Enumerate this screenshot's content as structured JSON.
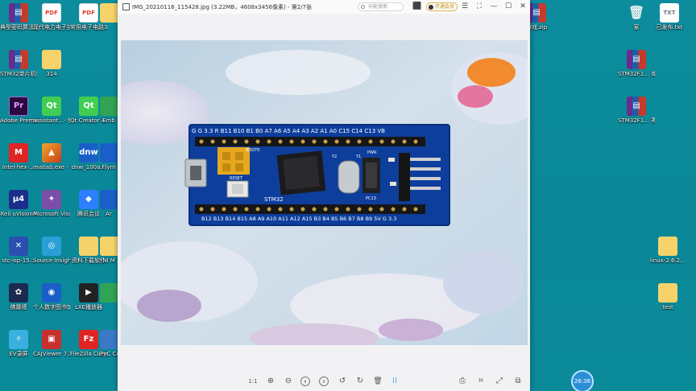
{
  "desktop": {
    "left_icons": [
      {
        "name": "rar-archive-icon",
        "label": "典型密码算法及其C语言…",
        "style": "g-rar",
        "glyph": "▤"
      },
      {
        "name": "pdf-file-icon",
        "label": "现代电力电子技术.pdf",
        "style": "g-pdf",
        "glyph": "PDF"
      },
      {
        "name": "pdf-file-icon",
        "label": "常用电子电路365例.pdf",
        "style": "g-pdf",
        "glyph": "PDF"
      },
      {
        "name": "rar-archive-icon",
        "label": "STM32单片机快速入…",
        "style": "g-rar",
        "glyph": "▤"
      },
      {
        "name": "folder-icon",
        "label": "314",
        "style": "g-folder",
        "glyph": ""
      },
      {
        "name": "premiere-icon",
        "label": "Adobe Premie…",
        "style": "g-pr",
        "glyph": "Pr"
      },
      {
        "name": "qt-assistant-icon",
        "label": "assistant…- 快捷方式",
        "style": "g-qt",
        "glyph": "Qt"
      },
      {
        "name": "qt-creator-icon",
        "label": "Qt Creator 4.8.0 (Ent…",
        "style": "g-qt",
        "glyph": "Qt"
      },
      {
        "name": "intel-hex-icon",
        "label": "Intel-hex-…",
        "style": "g-red",
        "glyph": "M"
      },
      {
        "name": "matlab-icon",
        "label": "matlab.exe - 快捷方式",
        "style": "g-matlab",
        "glyph": "▲"
      },
      {
        "name": "dnw-icon",
        "label": "dnw_100a…",
        "style": "g-blue",
        "glyph": "dnw"
      },
      {
        "name": "keil-icon",
        "label": "Keil uVision4",
        "style": "g-keil",
        "glyph": "μ4"
      },
      {
        "name": "visual-studio-icon",
        "label": "Microsoft Visual C…",
        "style": "g-vs",
        "glyph": "✦"
      },
      {
        "name": "tencent-meeting-icon",
        "label": "腾讯会议",
        "style": "g-meet",
        "glyph": "◆"
      },
      {
        "name": "stc-isp-icon",
        "label": "stc-isp-15…",
        "style": "g-stc",
        "glyph": "✕"
      },
      {
        "name": "source-insight-icon",
        "label": "Source Insight 3.5",
        "style": "g-si",
        "glyph": "◎"
      },
      {
        "name": "folder-icon",
        "label": "资料下载软件",
        "style": "g-folder",
        "glyph": ""
      },
      {
        "name": "firewall-icon",
        "label": "佛跳墙",
        "style": "g-fw",
        "glyph": "✿"
      },
      {
        "name": "digital-library-icon",
        "label": "个人数字图书馆2.1",
        "style": "g-blue",
        "glyph": "◉"
      },
      {
        "name": "lxe-player-icon",
        "label": "LXE播放器",
        "style": "g-lxe",
        "glyph": "▶"
      },
      {
        "name": "ev-recorder-icon",
        "label": "EV录屏",
        "style": "g-ev",
        "glyph": "✧"
      },
      {
        "name": "cajviewer-icon",
        "label": "CAJViewer 7.3",
        "style": "g-caj",
        "glyph": "▣"
      },
      {
        "name": "filezilla-icon",
        "label": "FileZilla Client",
        "style": "g-red",
        "glyph": "Fz"
      }
    ],
    "partial_icons": [
      {
        "name": "partial-folder-icon",
        "label": "",
        "style": "g-folder",
        "glyph": ""
      },
      {
        "name": "partial-embed-icon",
        "label": "Emb",
        "style": "g-green",
        "glyph": ""
      },
      {
        "name": "partial-fly-icon",
        "label": "Flym",
        "style": "g-blue",
        "glyph": ""
      },
      {
        "name": "partial-ar-icon",
        "label": "Ar",
        "style": "g-blue",
        "glyph": ""
      },
      {
        "name": "partial-ni-icon",
        "label": "NI M",
        "style": "g-folder",
        "glyph": ""
      },
      {
        "name": "partial-green-icon",
        "label": "",
        "style": "g-green",
        "glyph": ""
      },
      {
        "name": "partial-pycharm-icon",
        "label": "PyC Com",
        "style": "g-py",
        "glyph": ""
      }
    ],
    "right_icons": [
      {
        "name": "rar-archive-icon",
        "label": "游戏.zip",
        "style": "g-rar",
        "glyph": "▤"
      },
      {
        "name": "recycle-bin-icon",
        "label": "家",
        "style": "g-trash",
        "glyph": "🗑"
      },
      {
        "name": "text-file-icon",
        "label": "已发布.txt",
        "style": "g-file",
        "glyph": "TXT"
      },
      {
        "name": "rar-archive-icon",
        "label": "STM32F1… 库函数教…",
        "style": "g-rar",
        "glyph": "▤"
      },
      {
        "name": "rar-archive-icon",
        "label": "STM32F1… 寄存器版…",
        "style": "g-rar",
        "glyph": "▤"
      },
      {
        "name": "folder-icon",
        "label": "linux-2.6.2…",
        "style": "g-folder",
        "glyph": ""
      },
      {
        "name": "folder-icon",
        "label": "test",
        "style": "g-folder",
        "glyph": ""
      }
    ]
  },
  "viewer": {
    "title": "IMG_20210116_115428.jpg (3.22MB，4608x3456像素) - 第2/7张",
    "search_placeholder": "功能搜索",
    "vip_label": "开通会员",
    "window_buttons": {
      "menu": "☰",
      "fullscreen": "⛶",
      "minimize": "—",
      "maximize": "☐",
      "close": "✕"
    },
    "photo": {
      "top_pins": "G G 3.3 R B11 B10 B1 B0 A7 A6 A5 A4 A3 A2 A1 A0 C15 C14 C13 VB",
      "bottom_pins": "B12 B13 B14 B15 A8 A9 A10 A11 A12 A15 B3 B4 B5 B6 B7 B8 B9 5V G 3.3",
      "board_label": "STM32",
      "reset_label": "RESET",
      "boot_label": "BOOT0",
      "pwr_label": "PWR",
      "pc13_label": "PC13",
      "y1_label": "Y1",
      "y2_label": "Y2"
    },
    "toolbar": {
      "actual_size": "1:1",
      "zoom_in": "⊕",
      "zoom_out": "⊖",
      "prev": "‹",
      "next": "›",
      "rotate_left": "↺",
      "rotate_right": "↻",
      "delete": "🗑",
      "more": "⁞⁞",
      "print": "⎙",
      "ocr": "⌗",
      "crop": "⤢",
      "screenshot": "⧉"
    }
  },
  "clock": {
    "time": "26:36"
  }
}
